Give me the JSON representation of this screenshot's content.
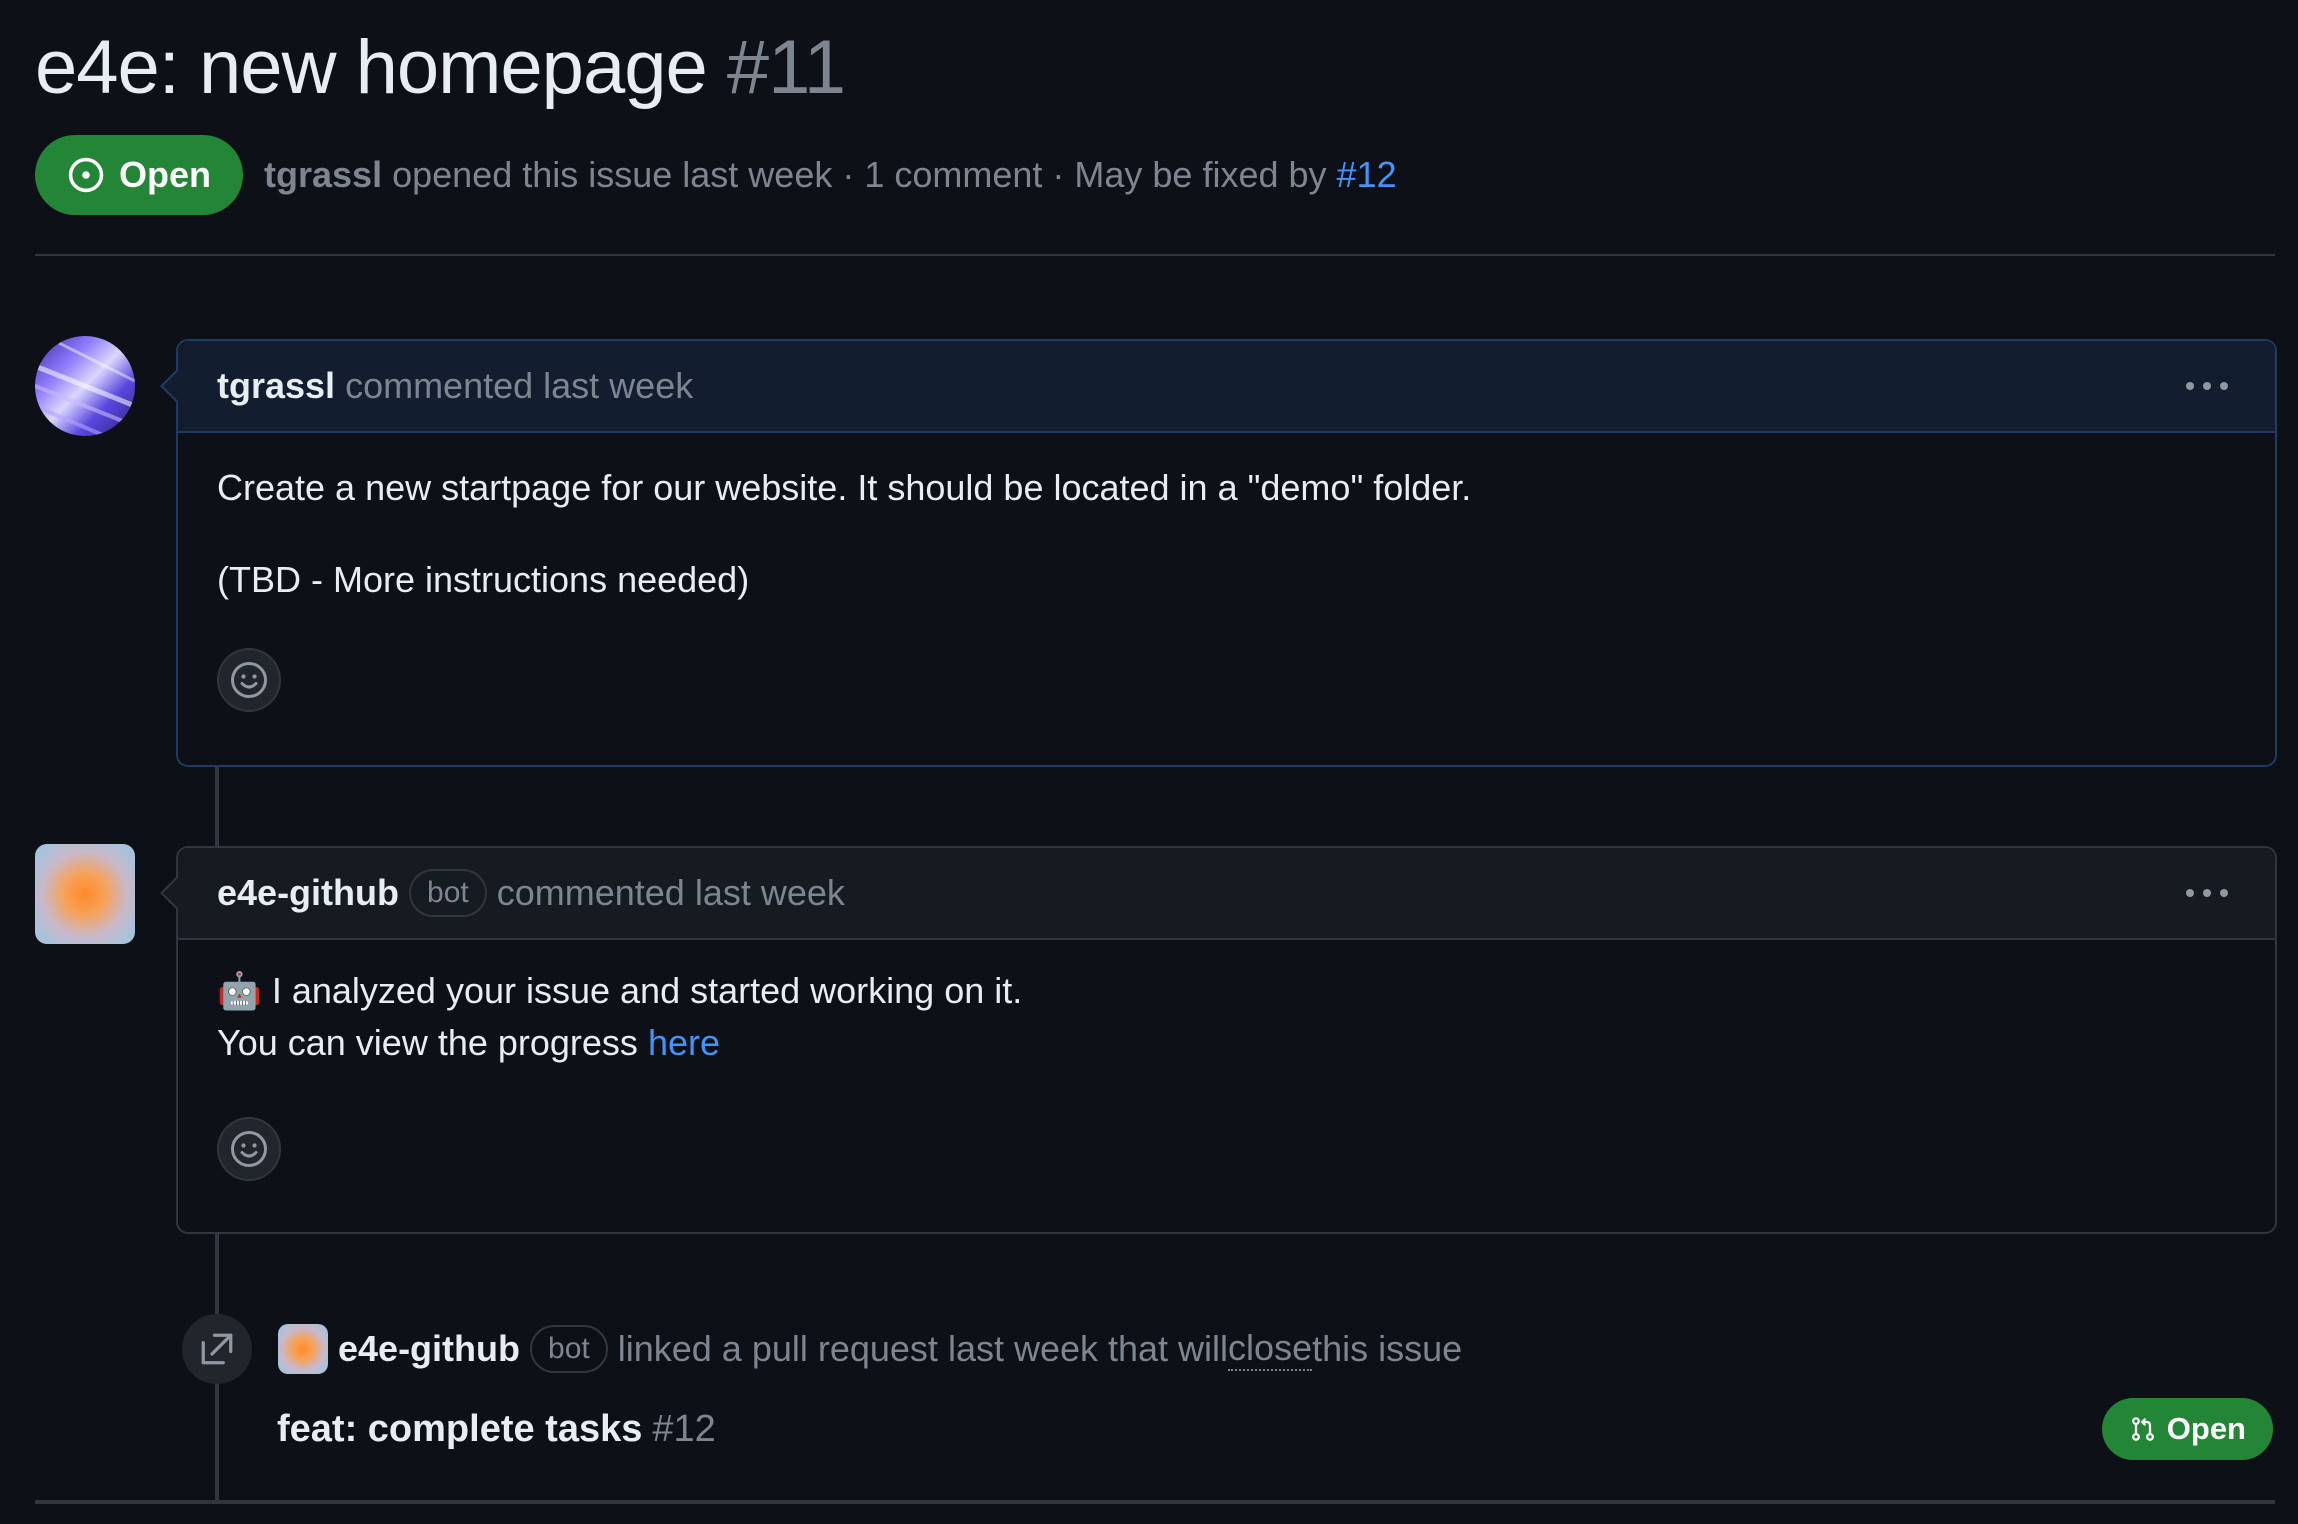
{
  "issue": {
    "title": "e4e: new homepage",
    "number": "#11",
    "state": "Open",
    "author": "tgrassl",
    "meta_text": " opened this issue last week · 1 comment · May be fixed by ",
    "linked_pr_ref": "#12"
  },
  "comments": [
    {
      "author": "tgrassl",
      "action": "commented last week",
      "avatar_icon": "holographic-avatar",
      "body": [
        "Create a new startpage for our website. It should be located in a \"demo\" folder.",
        "(TBD - More instructions needed)"
      ]
    },
    {
      "author": "e4e-github",
      "badge": "bot",
      "action": "commented last week",
      "avatar_icon": "gradient-avatar",
      "body_line1": "I analyzed your issue and started working on it.",
      "body_line2_prefix": "You can view the progress ",
      "body_link": "here",
      "emoji": "🤖"
    }
  ],
  "event": {
    "actor": "e4e-github",
    "badge": "bot",
    "text_before": "linked a pull request last week that will ",
    "close_word": "close",
    "text_after": " this issue",
    "pr_title": "feat: complete tasks",
    "pr_number": "#12",
    "pr_state": "Open"
  },
  "colors": {
    "background": "#0d1117",
    "open_green": "#238636",
    "link_blue": "#4493f8",
    "muted": "#7d8590"
  }
}
